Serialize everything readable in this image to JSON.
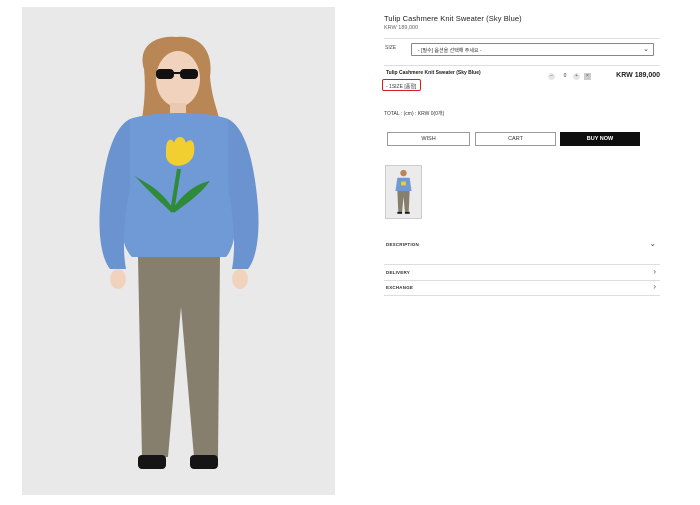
{
  "product": {
    "title": "Tulip Cashmere Knit Sweater (Sky Blue)",
    "price": "KRW 189,000"
  },
  "size": {
    "label": "SIZE",
    "select_value": "- [필수] 옵션을 선택해 주세요 -"
  },
  "selected_item": {
    "name": "Tulip Cashmere Knit Sweater (Sky Blue)",
    "option": "- 1SIZE [품절]",
    "quantity": "0",
    "price": "KRW 189,000"
  },
  "total": {
    "text": "TOTAL : (cm) : KRW 0(0개)"
  },
  "buttons": {
    "wish": "WISH",
    "cart": "CART",
    "buy_now": "BUY NOW"
  },
  "sections": [
    {
      "label": "DESCRIPTION",
      "icon": "chevron-down-icon"
    },
    {
      "label": "DELIVERY",
      "icon": "chevron-right-icon"
    },
    {
      "label": "EXCHANGE",
      "icon": "chevron-right-icon"
    }
  ],
  "colors": {
    "sweater": "#6f9ad6",
    "pants": "#877f6d",
    "flower": "#f2cf30",
    "stem": "#2f8a3a",
    "highlight": "#d21f1f",
    "buy_button": "#0e0e0e",
    "photo_bg": "#e9e9ea"
  }
}
